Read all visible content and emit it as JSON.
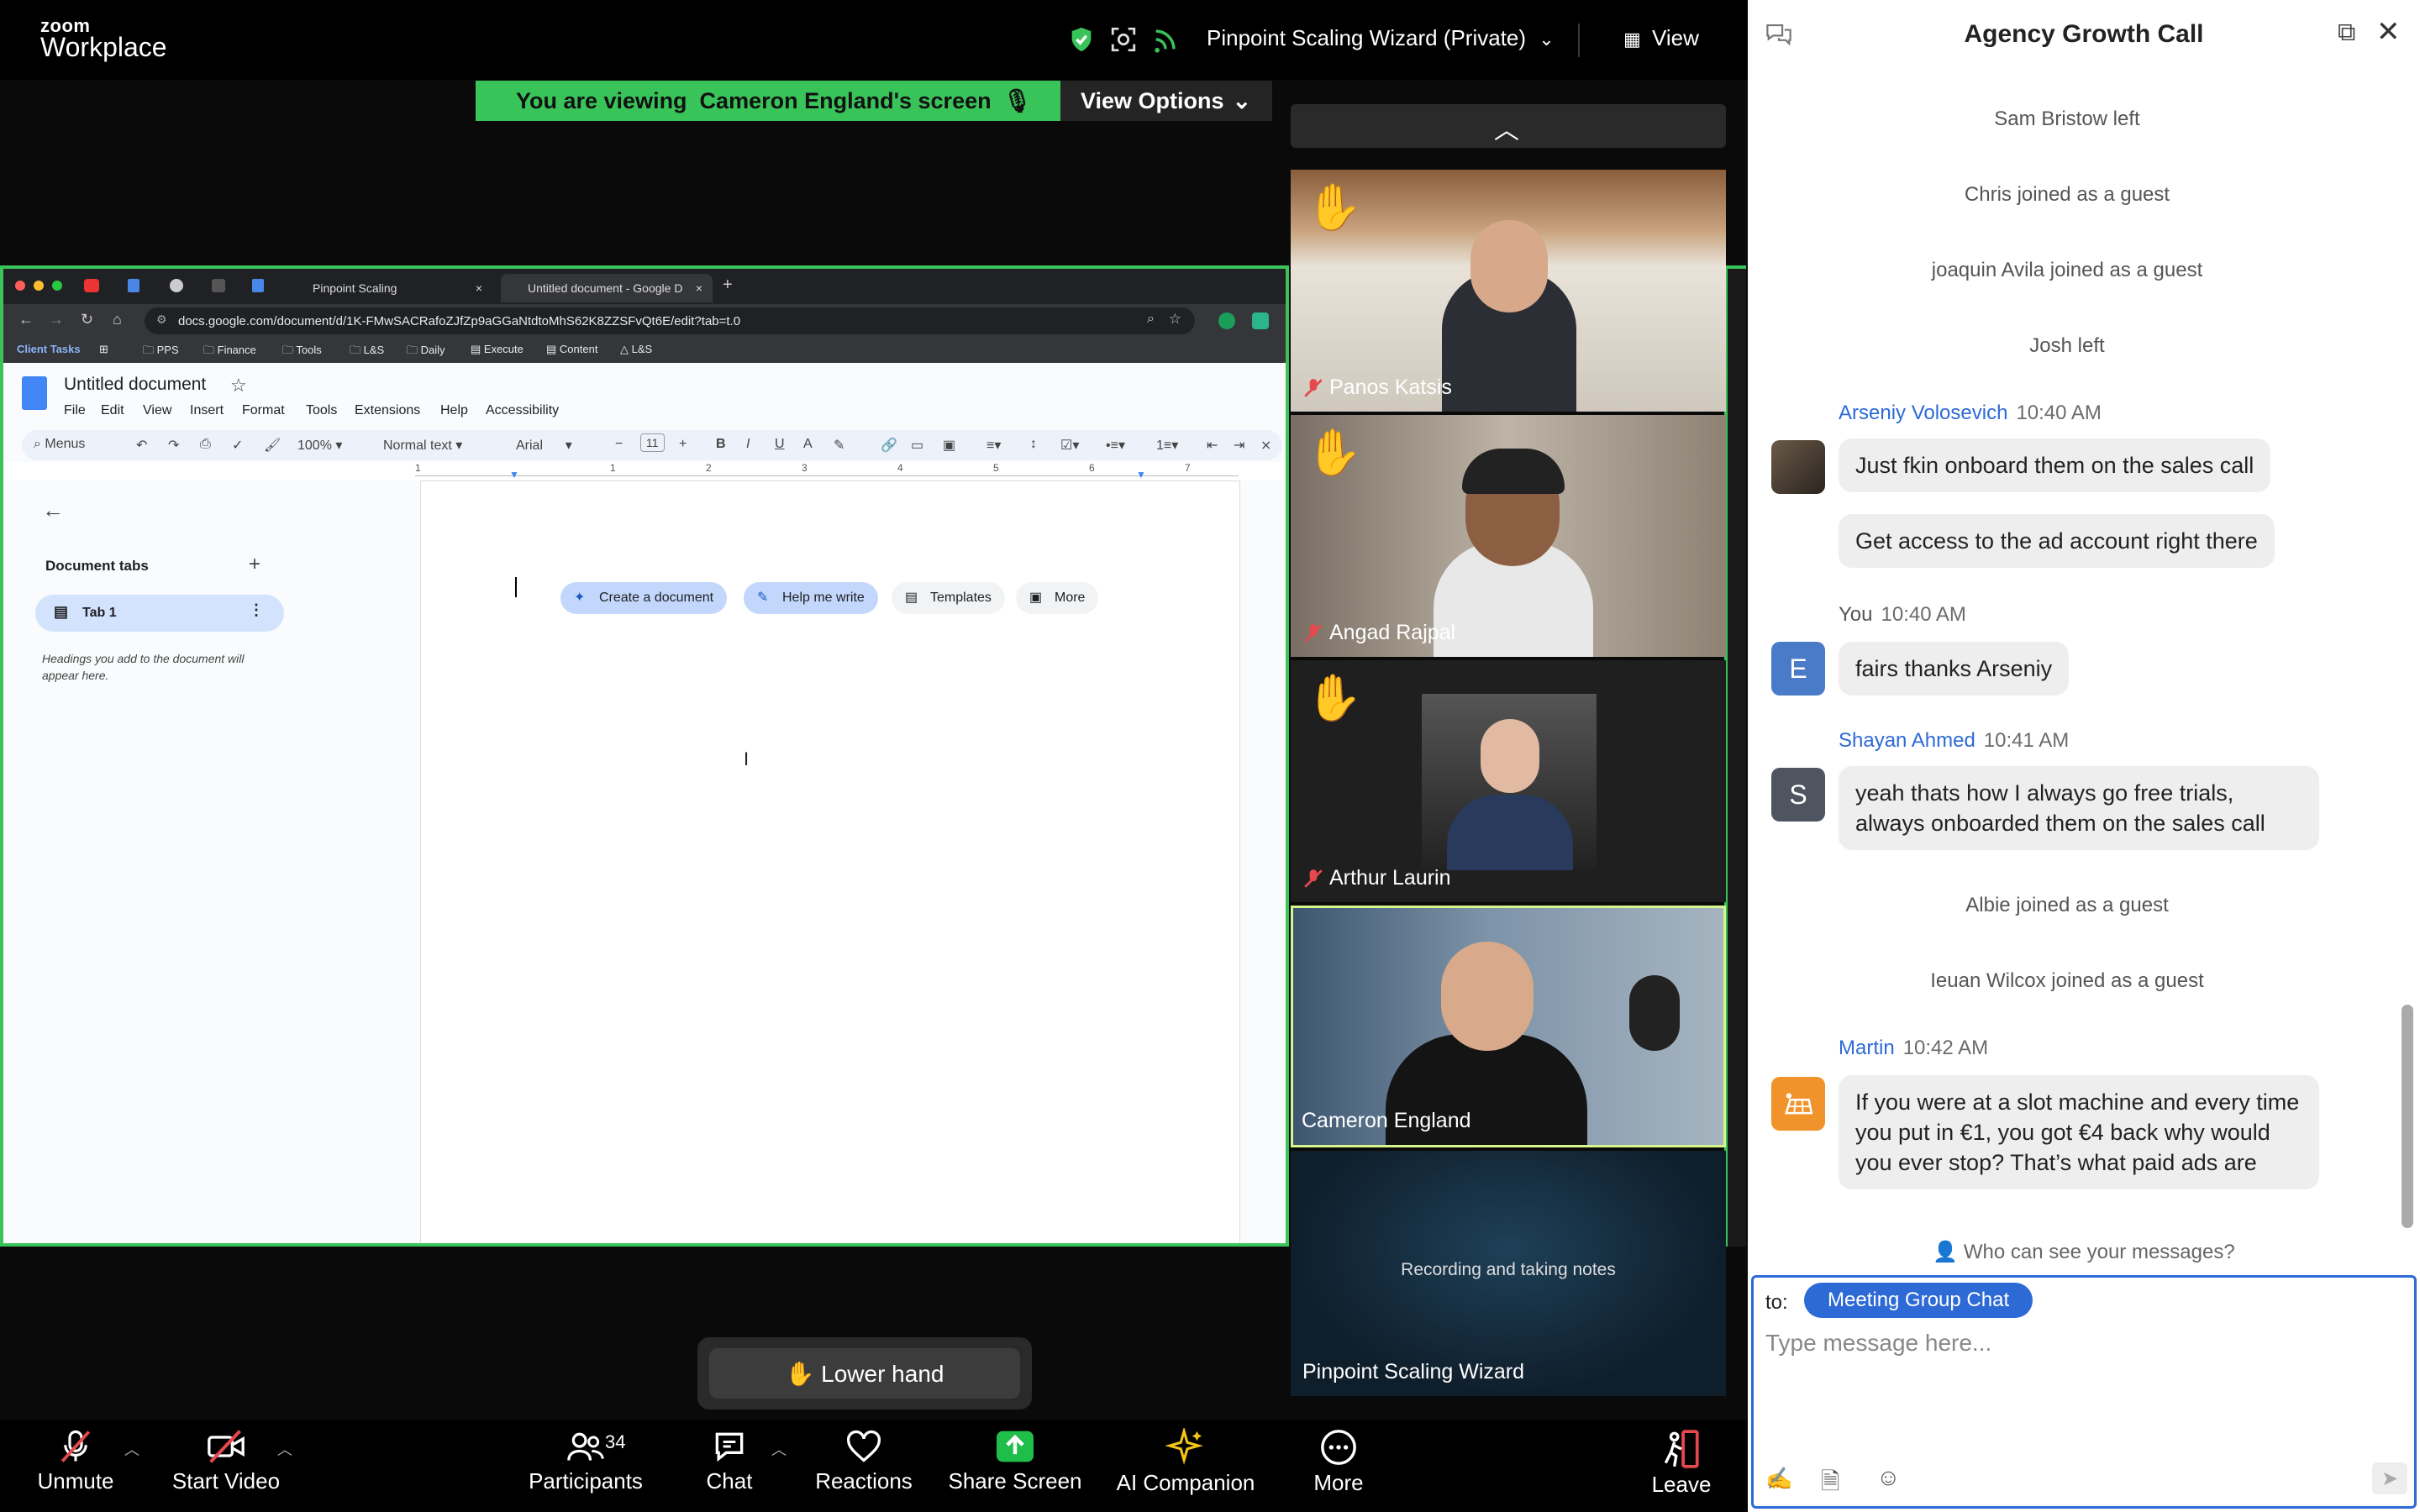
{
  "app": {
    "brand_top": "zoom",
    "brand_bottom": "Workplace"
  },
  "topbar": {
    "meeting_name": "Pinpoint Scaling Wizard (Private)",
    "view_label": "View"
  },
  "banner": {
    "text": "You are viewing  Cameron England's screen",
    "view_options": "View Options"
  },
  "browser": {
    "tabs": [
      "Pinpoint Scaling",
      "Untitled document - Google D"
    ],
    "url": "docs.google.com/document/d/1K-FMwSACRafoZJfZp9aGGaNtdtoMhS62K8ZZSFvQt6E/edit?tab=t.0",
    "bookmarks": [
      "Client Tasks",
      "PPS",
      "Finance",
      "Tools",
      "L&S",
      "Daily",
      "Execute",
      "Content",
      "L&S"
    ]
  },
  "docs": {
    "title": "Untitled document",
    "menus": [
      "File",
      "Edit",
      "View",
      "Insert",
      "Format",
      "Tools",
      "Extensions",
      "Help",
      "Accessibility"
    ],
    "toolbar": {
      "menus": "Menus",
      "zoom": "100%",
      "style": "Normal text",
      "font": "Arial",
      "size": "11"
    },
    "ruler": [
      "1",
      "1",
      "2",
      "3",
      "4",
      "5",
      "6",
      "7"
    ],
    "sidebar": {
      "title": "Document tabs",
      "tab": "Tab 1",
      "hint": "Headings you add to the document will appear here."
    },
    "chips": [
      "Create a document",
      "Help me write",
      "Templates",
      "More"
    ]
  },
  "participants": [
    {
      "name": "Panos Katsis",
      "hand": true,
      "muted": true
    },
    {
      "name": "Angad Rajpal",
      "hand": true,
      "muted": true
    },
    {
      "name": "Arthur Laurin",
      "hand": true,
      "muted": true
    },
    {
      "name": "Cameron England",
      "hand": false,
      "muted": false
    },
    {
      "name": "Pinpoint Scaling Wizard",
      "status": "Recording and taking notes"
    }
  ],
  "raised_hand": {
    "label": "✋ Lower hand"
  },
  "bottombar": {
    "unmute": "Unmute",
    "start_video": "Start Video",
    "participants": "Participants",
    "participants_count": "34",
    "chat": "Chat",
    "reactions": "Reactions",
    "share_screen": "Share Screen",
    "ai_companion": "AI Companion",
    "more": "More",
    "leave": "Leave"
  },
  "chat": {
    "title": "Agency Growth Call",
    "system": [
      "Sam Bristow left",
      "Chris joined as a guest",
      "joaquin Avila joined as a guest",
      "Josh left",
      "Albie joined as a guest",
      "Ieuan Wilcox joined as a guest"
    ],
    "messages": [
      {
        "sender": "Arseniy Volosevich",
        "time": "10:40 AM",
        "texts": [
          "Just fkin onboard them on the sales call",
          "Get access to the ad account right there"
        ]
      },
      {
        "sender": "You",
        "time": "10:40 AM",
        "avatar": "E",
        "texts": [
          "fairs thanks Arseniy"
        ]
      },
      {
        "sender": "Shayan Ahmed",
        "time": "10:41 AM",
        "avatar": "S",
        "texts": [
          "yeah thats how I always go free trials, always onboarded them on the sales call"
        ]
      },
      {
        "sender": "Martin",
        "time": "10:42 AM",
        "texts": [
          "If you were at a slot machine and every time you put in €1, you got €4 back why would you ever stop? That’s what paid ads are"
        ]
      }
    ],
    "who_can_see": "Who can see your messages?",
    "to_label": "to:",
    "to_target": "Meeting Group Chat",
    "placeholder": "Type message here..."
  },
  "colors": {
    "accent_green": "#39c45a",
    "accent_blue": "#2d6ad6",
    "leave_red": "#e5484d"
  }
}
